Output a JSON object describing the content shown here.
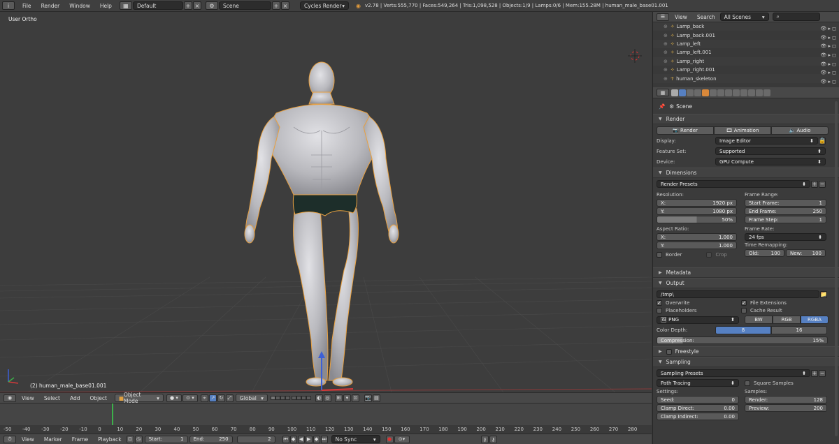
{
  "topbar": {
    "menus": [
      "File",
      "Render",
      "Window",
      "Help"
    ],
    "layout": "Default",
    "scene": "Scene",
    "engine": "Cycles Render",
    "stats": "v2.78 | Verts:555,770 | Faces:549,264 | Tris:1,098,528 | Objects:1/9 | Lamps:0/6 | Mem:155.28M | human_male_base01.001"
  },
  "viewport": {
    "view_label": "User Ortho",
    "object_label": "(2) human_male_base01.001"
  },
  "viewport_header": {
    "menus": [
      "View",
      "Select",
      "Add",
      "Object"
    ],
    "mode": "Object Mode",
    "orientation": "Global"
  },
  "timeline": {
    "ticks": [
      "-50",
      "-40",
      "-30",
      "-20",
      "-10",
      "0",
      "10",
      "20",
      "30",
      "40",
      "50",
      "60",
      "70",
      "80",
      "90",
      "100",
      "110",
      "120",
      "130",
      "140",
      "150",
      "160",
      "170",
      "180",
      "190",
      "200",
      "210",
      "220",
      "230",
      "240",
      "250",
      "260",
      "270",
      "280"
    ],
    "current_frame_tick": "0",
    "menus": [
      "View",
      "Marker",
      "Frame",
      "Playback"
    ],
    "start_label": "Start:",
    "start_value": "1",
    "end_label": "End:",
    "end_value": "250",
    "current": "2",
    "sync": "No Sync"
  },
  "outliner": {
    "menus": [
      "View",
      "Search"
    ],
    "filter": "All Scenes",
    "items": [
      "Lamp_back",
      "Lamp_back.001",
      "Lamp_left",
      "Lamp_left.001",
      "Lamp_right",
      "Lamp_right.001",
      "human_skeleton"
    ]
  },
  "properties": {
    "context": "Scene",
    "render": {
      "title": "Render",
      "buttons": [
        "Render",
        "Animation",
        "Audio"
      ],
      "display_label": "Display:",
      "display": "Image Editor",
      "feature_label": "Feature Set:",
      "feature": "Supported",
      "device_label": "Device:",
      "device": "GPU Compute"
    },
    "dimensions": {
      "title": "Dimensions",
      "presets": "Render Presets",
      "resolution_label": "Resolution:",
      "res_x_label": "X:",
      "res_x": "1920 px",
      "res_y_label": "Y:",
      "res_y": "1080 px",
      "res_pct": "50%",
      "aspect_label": "Aspect Ratio:",
      "asp_x_label": "X:",
      "asp_x": "1.000",
      "asp_y_label": "Y:",
      "asp_y": "1.000",
      "border": "Border",
      "crop": "Crop",
      "frame_range_label": "Frame Range:",
      "start_label": "Start Frame:",
      "start": "1",
      "end_label": "End Frame:",
      "end": "250",
      "step_label": "Frame Step:",
      "step": "1",
      "frame_rate_label": "Frame Rate:",
      "frame_rate": "24 fps",
      "remap_label": "Time Remapping:",
      "old_label": "Old:",
      "old": "100",
      "new_label": "New:",
      "new": "100"
    },
    "metadata_title": "Metadata",
    "output": {
      "title": "Output",
      "path": "/tmp\\",
      "overwrite": "Overwrite",
      "file_ext": "File Extensions",
      "placeholders": "Placeholders",
      "cache": "Cache Result",
      "format": "PNG",
      "bw": "BW",
      "rgb": "RGB",
      "rgba": "RGBA",
      "depth_label": "Color Depth:",
      "depth8": "8",
      "depth16": "16",
      "compression_label": "Compression:",
      "compression": "15%",
      "compression_fraction": 0.15
    },
    "freestyle_title": "Freestyle",
    "sampling": {
      "title": "Sampling",
      "presets": "Sampling Presets",
      "integrator": "Path Tracing",
      "square": "Square Samples",
      "settings_label": "Settings:",
      "seed_label": "Seed:",
      "seed": "0",
      "clamp_d_label": "Clamp Direct:",
      "clamp_d": "0.00",
      "clamp_i_label": "Clamp Indirect:",
      "clamp_i": "0.00",
      "samples_label": "Samples:",
      "render_label": "Render:",
      "render": "128",
      "preview_label": "Preview:",
      "preview": "200"
    }
  },
  "colors": {
    "accent": "#5680c2",
    "viewport_bg": "#3d3d3d",
    "panel_bg": "#3b3b3b"
  }
}
